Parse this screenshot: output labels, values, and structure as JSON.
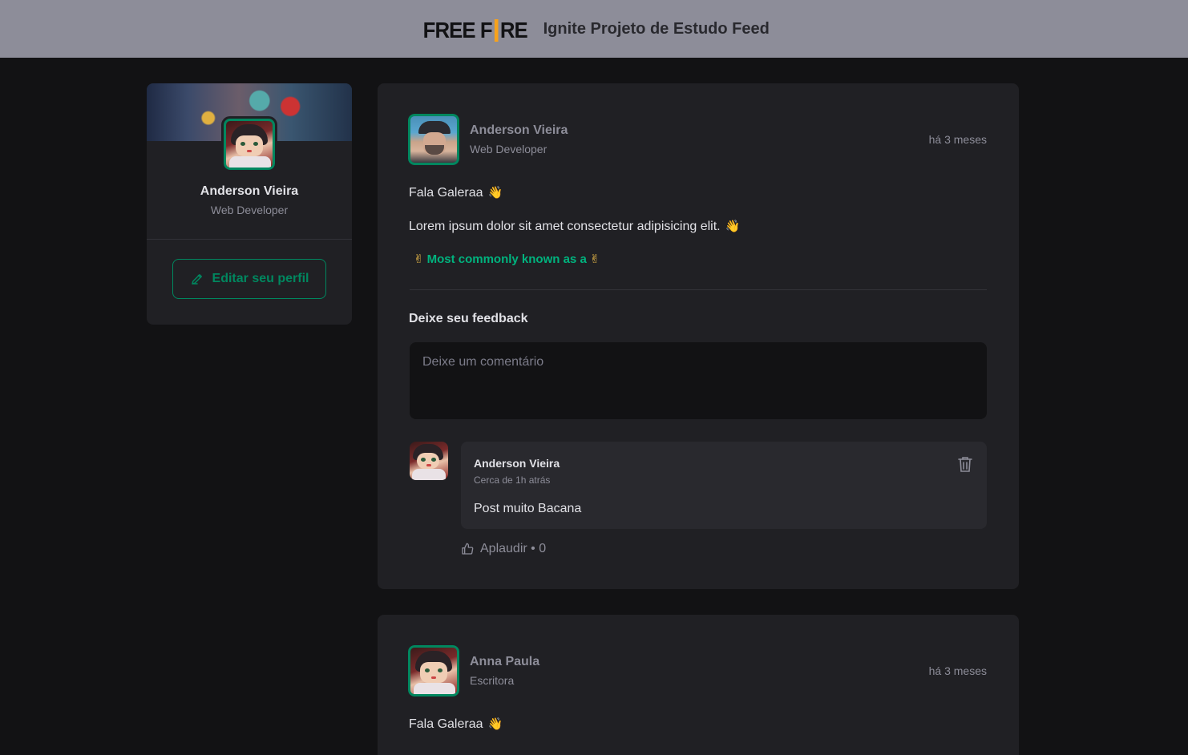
{
  "header": {
    "logo_left": "FREE F",
    "logo_right": "RE",
    "title": "Ignite Projeto de Estudo Feed"
  },
  "sidebar": {
    "name": "Anderson Vieira",
    "role": "Web Developer",
    "edit_label": "Editar seu perfil"
  },
  "posts": [
    {
      "author": "Anderson Vieira",
      "role": "Web Developer",
      "time": "há 3 meses",
      "lines": [
        "Fala Galeraa",
        "Lorem ipsum dolor sit amet consectetur adipisicing elit."
      ],
      "hashtag": "Most commonly known as a",
      "feedback_title": "Deixe seu feedback",
      "comment_placeholder": "Deixe um comentário",
      "comment": {
        "author": "Anderson Vieira",
        "time": "Cerca de 1h atrás",
        "text": "Post muito Bacana",
        "applaud_label": "Aplaudir • 0"
      }
    },
    {
      "author": "Anna Paula",
      "role": "Escritora",
      "time": "há 3 meses",
      "lines": [
        "Fala Galeraa"
      ]
    }
  ],
  "emoji": {
    "wave": "👋",
    "victory": "✌"
  },
  "colors": {
    "accent": "#00875f",
    "accent_light": "#00b37e",
    "header_bg": "#8d8d99",
    "page_bg": "#121214",
    "card_bg": "#202024"
  }
}
